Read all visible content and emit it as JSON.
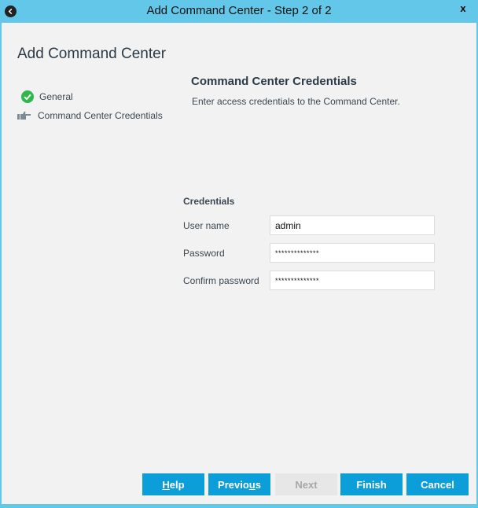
{
  "window": {
    "title": "Add Command Center - Step 2 of 2",
    "close_label": "x"
  },
  "wizard": {
    "heading": "Add Command Center",
    "steps": [
      {
        "label": "General",
        "icon": "check-circle-icon",
        "status": "done"
      },
      {
        "label": "Command Center Credentials",
        "icon": "pointing-hand-icon",
        "status": "current"
      }
    ]
  },
  "main": {
    "section_title": "Command Center Credentials",
    "section_desc": "Enter access credentials to the Command Center.",
    "group_title": "Credentials",
    "fields": {
      "username": {
        "label": "User name",
        "value": "admin"
      },
      "password": {
        "label": "Password",
        "value": "**************"
      },
      "confirm": {
        "label": "Confirm password",
        "value": "**************"
      }
    }
  },
  "buttons": {
    "help": {
      "pre": "",
      "accel": "H",
      "post": "elp"
    },
    "previous": {
      "pre": "Previo",
      "accel": "u",
      "post": "s"
    },
    "next": {
      "label": "Next"
    },
    "finish": {
      "label": "Finish"
    },
    "cancel": {
      "label": "Cancel"
    }
  },
  "colors": {
    "titlebar": "#62c7e8",
    "button": "#0c9ed8",
    "button_disabled": "#e7e7e7",
    "check": "#2db84a"
  }
}
